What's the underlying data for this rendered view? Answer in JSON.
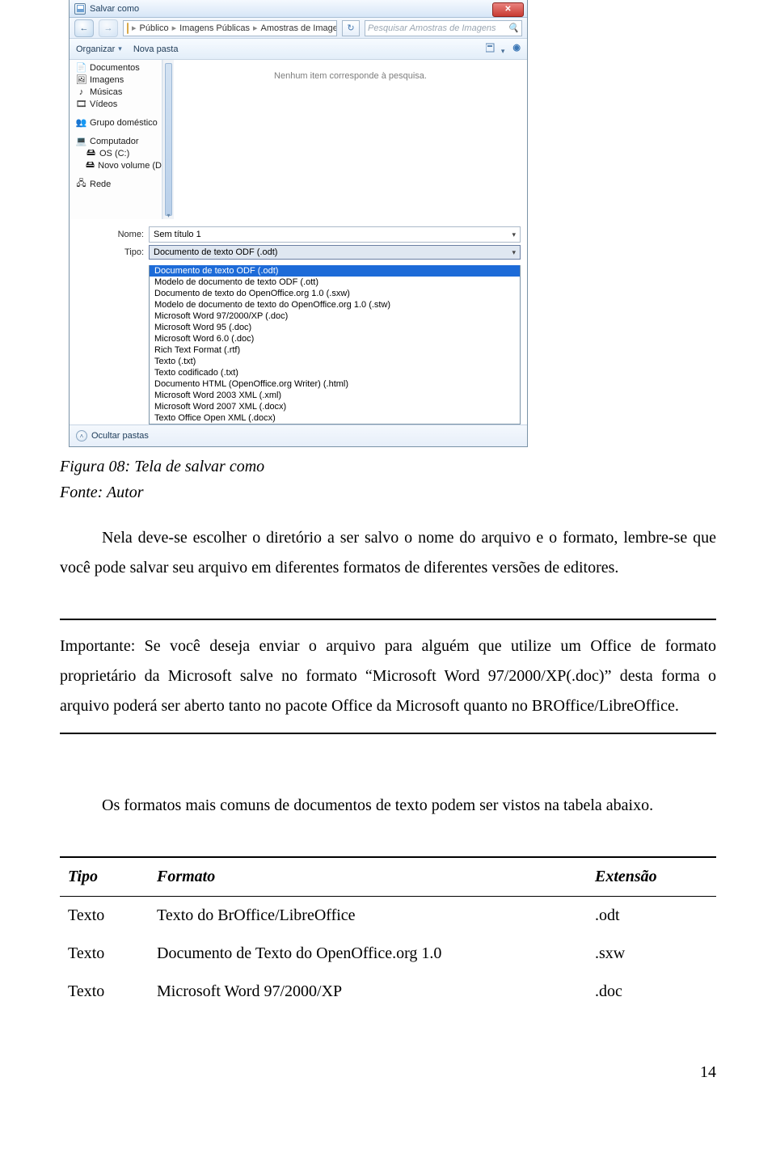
{
  "dialog": {
    "title": "Salvar como",
    "breadcrumbs": [
      "Público",
      "Imagens Públicas",
      "Amostras de Imagens"
    ],
    "search_placeholder": "Pesquisar Amostras de Imagens",
    "toolbar": {
      "organize": "Organizar",
      "newfolder": "Nova pasta"
    },
    "empty_message": "Nenhum item corresponde à pesquisa.",
    "sidebar": {
      "libs": [
        "Documentos",
        "Imagens",
        "Músicas",
        "Vídeos"
      ],
      "homegroup": "Grupo doméstico",
      "computer": "Computador",
      "drives": [
        "OS (C:)",
        "Novo volume (D:"
      ],
      "network": "Rede"
    },
    "fields": {
      "name_label": "Nome:",
      "name_value": "Sem título 1",
      "type_label": "Tipo:",
      "type_value": "Documento de texto ODF (.odt)",
      "options": [
        "Documento de texto ODF (.odt)",
        "Modelo de documento de texto ODF (.ott)",
        "Documento de texto do OpenOffice.org 1.0 (.sxw)",
        "Modelo de documento de texto do OpenOffice.org 1.0 (.stw)",
        "Microsoft Word 97/2000/XP (.doc)",
        "Microsoft Word 95 (.doc)",
        "Microsoft Word 6.0 (.doc)",
        "Rich Text Format (.rtf)",
        "Texto (.txt)",
        "Texto codificado (.txt)",
        "Documento HTML (OpenOffice.org Writer) (.html)",
        "Microsoft Word 2003 XML (.xml)",
        "Microsoft Word 2007 XML (.docx)",
        "Texto Office Open XML (.docx)"
      ]
    },
    "footer": {
      "hide": "Ocultar pastas"
    }
  },
  "doc": {
    "caption1": "Figura 08: Tela de salvar como",
    "caption2": "Fonte: Autor",
    "para1": "Nela deve-se escolher o diretório a ser salvo o nome do arquivo e o formato, lembre-se que você pode salvar seu arquivo em diferentes formatos de diferentes versões de editores.",
    "para2": "Importante: Se você deseja enviar o arquivo para alguém que utilize um Office de formato proprietário da Microsoft salve no formato “Microsoft Word 97/2000/XP(.doc)” desta forma o arquivo poderá ser aberto tanto no pacote Office da Microsoft quanto no BROffice/LibreOffice.",
    "tablelabel": "Os formatos mais comuns de documentos de texto podem ser vistos na tabela abaixo.",
    "table": {
      "headers": [
        "Tipo",
        "Formato",
        "Extensão"
      ],
      "rows": [
        [
          "Texto",
          "Texto do BrOffice/LibreOffice",
          ".odt"
        ],
        [
          "Texto",
          "Documento de Texto do OpenOffice.org 1.0",
          ".sxw"
        ],
        [
          "Texto",
          "Microsoft Word 97/2000/XP",
          ".doc"
        ]
      ]
    },
    "pagenum": "14"
  }
}
